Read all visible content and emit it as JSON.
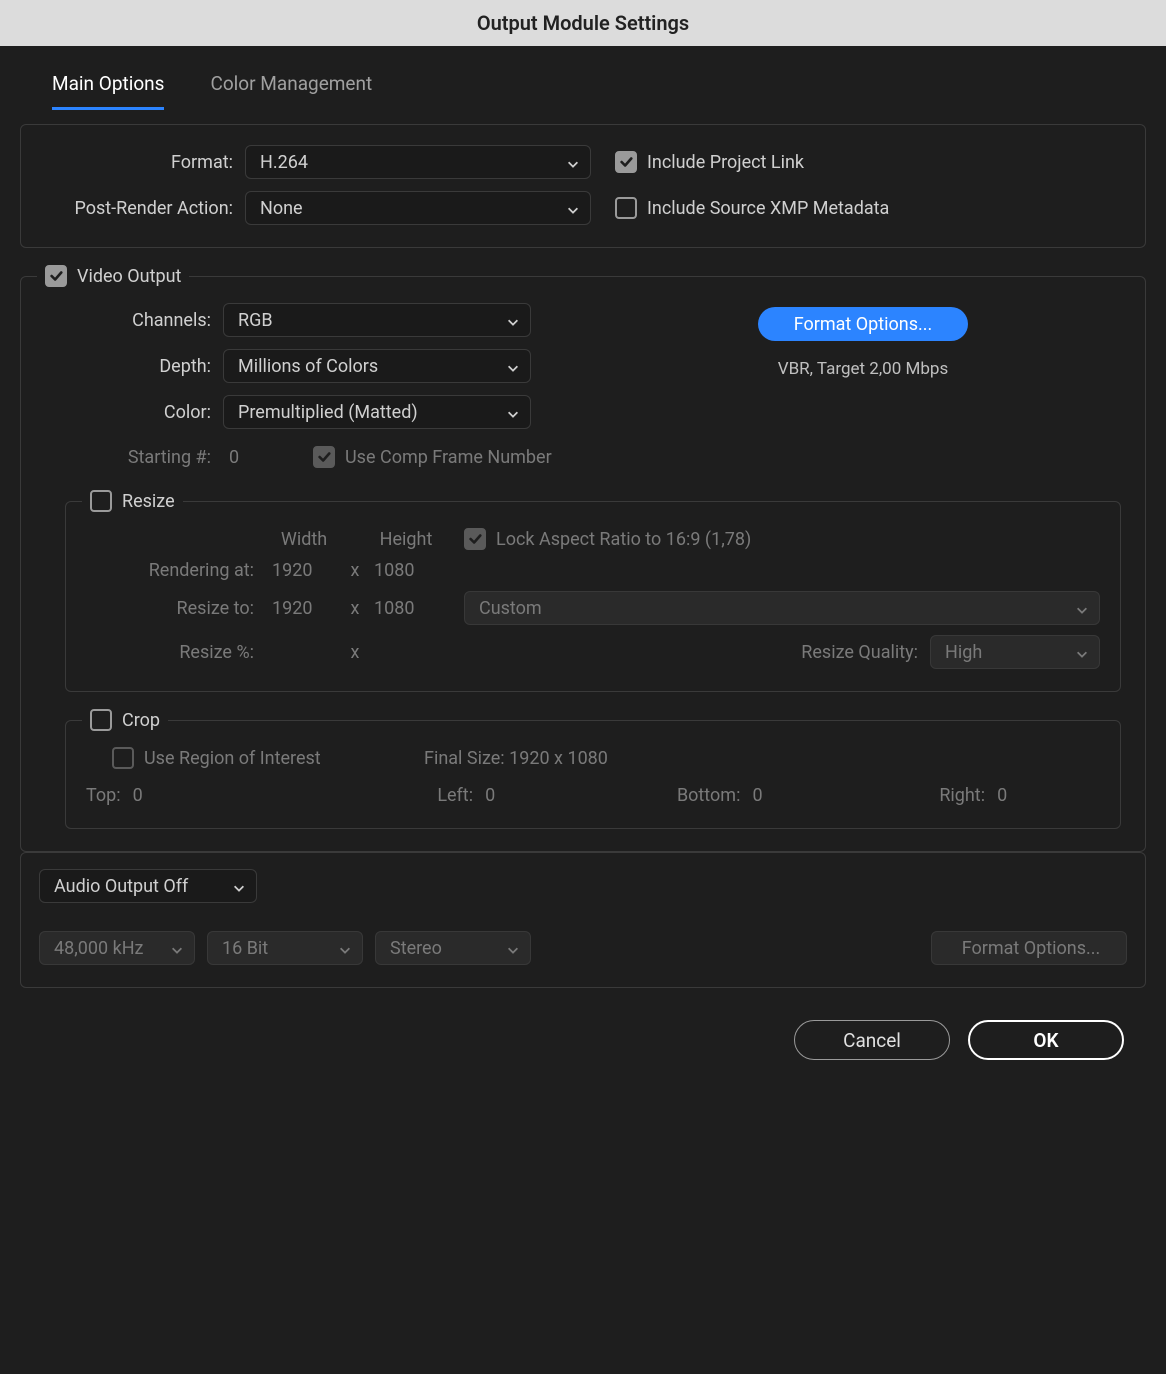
{
  "title": "Output Module Settings",
  "tabs": {
    "main": "Main Options",
    "color": "Color Management"
  },
  "top": {
    "format_label": "Format:",
    "format_value": "H.264",
    "post_render_label": "Post-Render Action:",
    "post_render_value": "None",
    "include_project_link": "Include Project Link",
    "include_xmp": "Include Source XMP Metadata"
  },
  "video": {
    "legend": "Video Output",
    "channels_label": "Channels:",
    "channels_value": "RGB",
    "depth_label": "Depth:",
    "depth_value": "Millions of Colors",
    "color_label": "Color:",
    "color_value": "Premultiplied (Matted)",
    "starting_label": "Starting #:",
    "starting_value": "0",
    "use_comp_frame": "Use Comp Frame Number",
    "format_options_btn": "Format Options...",
    "bitrate_info": "VBR, Target 2,00 Mbps"
  },
  "resize": {
    "legend": "Resize",
    "width_h": "Width",
    "height_h": "Height",
    "lock_ratio": "Lock Aspect Ratio to 16:9 (1,78)",
    "rendering_at": "Rendering at:",
    "r_w": "1920",
    "r_h": "1080",
    "resize_to": "Resize to:",
    "t_w": "1920",
    "t_h": "1080",
    "preset": "Custom",
    "resize_pct": "Resize %:",
    "quality_label": "Resize Quality:",
    "quality_value": "High",
    "x": "x"
  },
  "crop": {
    "legend": "Crop",
    "use_roi": "Use Region of Interest",
    "final_size": "Final Size: 1920 x 1080",
    "top": "Top:",
    "top_v": "0",
    "left": "Left:",
    "left_v": "0",
    "bottom": "Bottom:",
    "bottom_v": "0",
    "right": "Right:",
    "right_v": "0"
  },
  "audio": {
    "output": "Audio Output Off",
    "rate": "48,000 kHz",
    "bits": "16 Bit",
    "channels": "Stereo",
    "format_options": "Format Options..."
  },
  "buttons": {
    "cancel": "Cancel",
    "ok": "OK"
  }
}
